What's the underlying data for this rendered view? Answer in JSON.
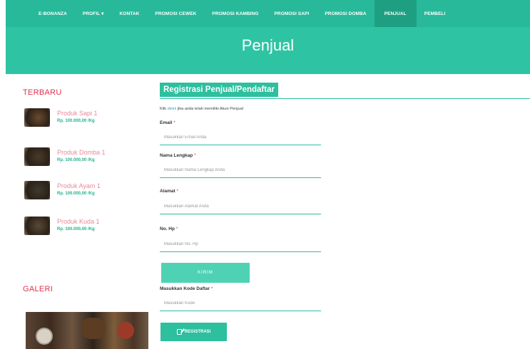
{
  "nav": {
    "items": [
      {
        "label": "E-BONANZA",
        "active": false
      },
      {
        "label": "PROFIL ▾",
        "active": false
      },
      {
        "label": "KONTAK",
        "active": false
      },
      {
        "label": "PROMOSI CEWEK",
        "active": false
      },
      {
        "label": "PROMOSI KAMBING",
        "active": false
      },
      {
        "label": "PROMOSI SAPI",
        "active": false
      },
      {
        "label": "PROMOSI DOMBA",
        "active": false
      },
      {
        "label": "PENJUAL",
        "active": true
      },
      {
        "label": "PEMBELI",
        "active": false
      }
    ]
  },
  "hero": {
    "title": "Penjual"
  },
  "sidebar": {
    "latest_heading": "TERBARU",
    "products": [
      {
        "name": "Produk Sapi 1",
        "price": "Rp. 100.000,00 /Kg",
        "thumb": "#6b4a30"
      },
      {
        "name": "Produk Domba 1",
        "price": "Rp. 100.000,00 /Kg",
        "thumb": "#4a3a2a"
      },
      {
        "name": "Produk Ayam 1",
        "price": "Rp. 100.000,00 /Kg",
        "thumb": "#3d3a2e"
      },
      {
        "name": "Produk Kuda 1",
        "price": "Rp. 100.000,00 /Kg",
        "thumb": "#5a4a36"
      }
    ],
    "gallery_heading": "GALERI"
  },
  "form": {
    "title": "Registrasi Penjual/Pendaftar",
    "info_prefix": "Klik",
    "info_link": "disini",
    "info_suffix": "jika anda telah memiliki Akun Penjual",
    "fields": [
      {
        "label": "Email",
        "placeholder": "Masukkan Email Anda"
      },
      {
        "label": "Nama Lengkap",
        "placeholder": "Masukkan Nama Lengkap Anda"
      },
      {
        "label": "Alamat",
        "placeholder": "Masukkan Alamat Anda"
      },
      {
        "label": "No. Hp",
        "placeholder": "Masukkan No. Hp"
      }
    ],
    "required_mark": "*",
    "send_label": "KIRIM",
    "code_label": "Masukkan Kode Daftar",
    "code_placeholder": "Masukkan Kode",
    "register_label": "REGISTRASI"
  },
  "colors": {
    "nav_bg": "#27b99a",
    "hero_bg": "#2ec4a3",
    "accent": "#2dbf9e",
    "heading_red": "#e2304d"
  }
}
